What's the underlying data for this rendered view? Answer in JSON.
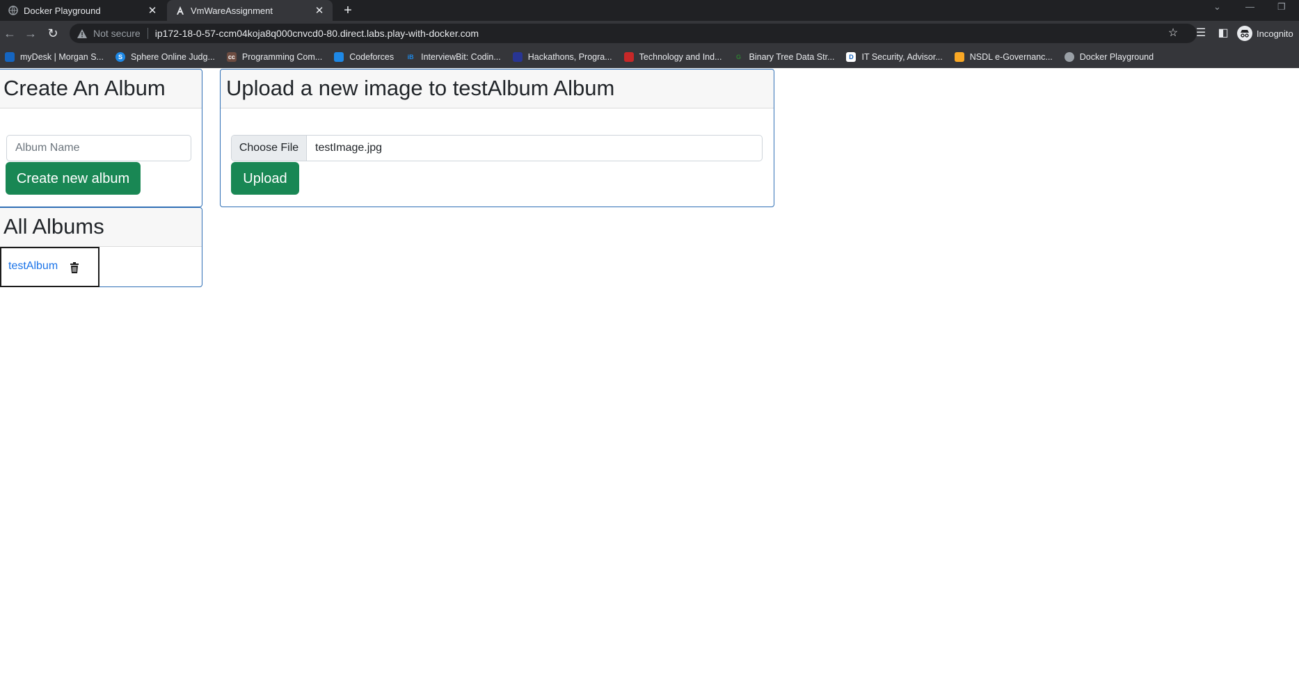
{
  "browser": {
    "tabs": [
      {
        "title": "Docker Playground",
        "icon": "docker-globe-icon",
        "active": false
      },
      {
        "title": "VmWareAssignment",
        "icon": "angular-icon",
        "active": true
      }
    ],
    "security_label": "Not secure",
    "url": "ip172-18-0-57-ccm04koja8q000cnvcd0-80.direct.labs.play-with-docker.com",
    "profile_label": "Incognito",
    "bookmarks": [
      {
        "label": "myDesk | Morgan S...",
        "icon": "mydesk-icon",
        "color": "#1565c0"
      },
      {
        "label": "Sphere Online Judg...",
        "icon": "spoj-icon",
        "color": "#1e88e5"
      },
      {
        "label": "Programming Com...",
        "icon": "codechef-icon",
        "color": "#6d4c41"
      },
      {
        "label": "Codeforces",
        "icon": "codeforces-icon",
        "color": "#1e88e5"
      },
      {
        "label": "InterviewBit: Codin...",
        "icon": "interviewbit-icon",
        "color": "#1e88e5"
      },
      {
        "label": "Hackathons, Progra...",
        "icon": "hackerearth-icon",
        "color": "#283593"
      },
      {
        "label": "Technology and Ind...",
        "icon": "tech-icon",
        "color": "#c62828"
      },
      {
        "label": "Binary Tree Data Str...",
        "icon": "gfg-icon",
        "color": "#2e7d32"
      },
      {
        "label": "IT Security, Advisor...",
        "icon": "dell-icon",
        "color": "#ffffff"
      },
      {
        "label": "NSDL e-Governanc...",
        "icon": "nsdl-icon",
        "color": "#f9a825"
      },
      {
        "label": "Docker Playground",
        "icon": "docker-globe-icon",
        "color": "#9aa0a6"
      }
    ]
  },
  "create_album": {
    "title": "Create An Album",
    "input_placeholder": "Album Name",
    "input_value": "",
    "button_label": "Create new album"
  },
  "all_albums": {
    "title": "All Albums",
    "albums": [
      {
        "name": "testAlbum"
      }
    ]
  },
  "upload": {
    "title": "Upload a new image to testAlbum Album",
    "choose_file_label": "Choose File",
    "file_name": "testImage.jpg",
    "button_label": "Upload"
  },
  "colors": {
    "primary_button": "#198754",
    "link": "#1a73e8",
    "card_border": "#2f6fb5"
  }
}
